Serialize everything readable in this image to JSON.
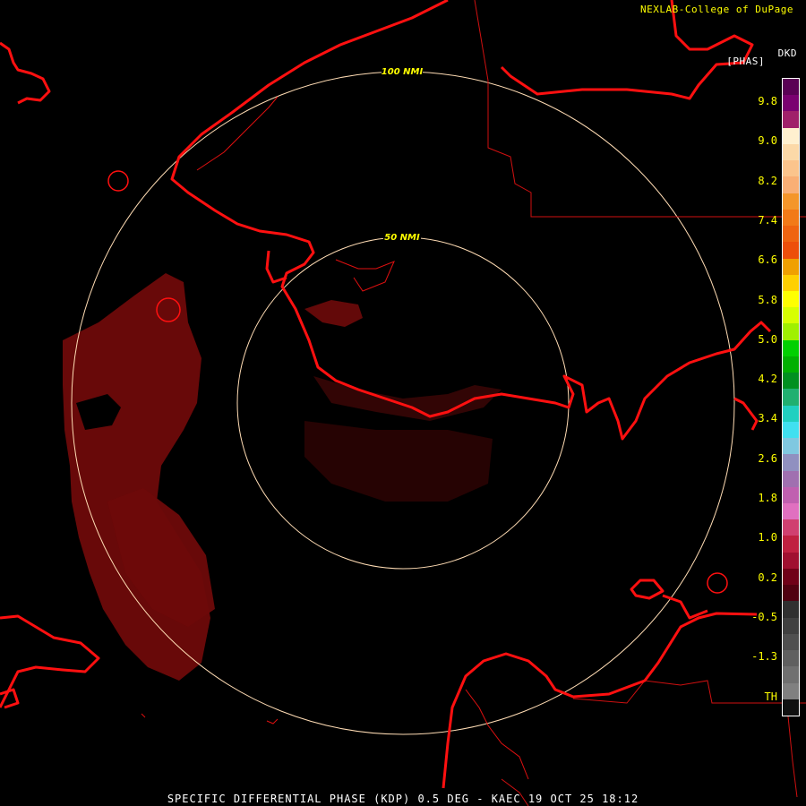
{
  "header": {
    "credit": "NEXLAB-College of DuPage",
    "product_code": "DKD",
    "units": "[PHAS]"
  },
  "footer": {
    "caption": "SPECIFIC DIFFERENTIAL PHASE (KDP) 0.5 DEG - KAEC 19 OCT 25 18:12"
  },
  "range_rings": [
    {
      "label": "100 NMI"
    },
    {
      "label": "50 NMI"
    }
  ],
  "legend": {
    "ticks": [
      "9.8",
      "9.0",
      "8.2",
      "7.4",
      "6.6",
      "5.8",
      "5.0",
      "4.2",
      "3.4",
      "2.6",
      "1.8",
      "1.0",
      "0.2",
      "-0.5",
      "-1.3",
      "TH"
    ],
    "colors": [
      "#5a0055",
      "#7a0070",
      "#a0206a",
      "#fff0cf",
      "#fcd9a8",
      "#fbc48c",
      "#f9af75",
      "#f4962a",
      "#f27a18",
      "#ef6410",
      "#ed4f0a",
      "#f0a000",
      "#ffd000",
      "#ffff00",
      "#d8ff00",
      "#a0f000",
      "#00d000",
      "#00b000",
      "#009020",
      "#20b070",
      "#20d0c0",
      "#40e0f0",
      "#80c8e0",
      "#9090c0",
      "#a070b0",
      "#c060b0",
      "#e070c0",
      "#d04070",
      "#c02040",
      "#a01030",
      "#700018",
      "#500010",
      "#303030",
      "#404040",
      "#505050",
      "#606060",
      "#707070",
      "#808080",
      "#101010"
    ]
  },
  "colors": {
    "coastline": "#ff1010",
    "border": "#d01010",
    "range_ring": "#ffdcb4",
    "echo": "#6e0a0a"
  }
}
